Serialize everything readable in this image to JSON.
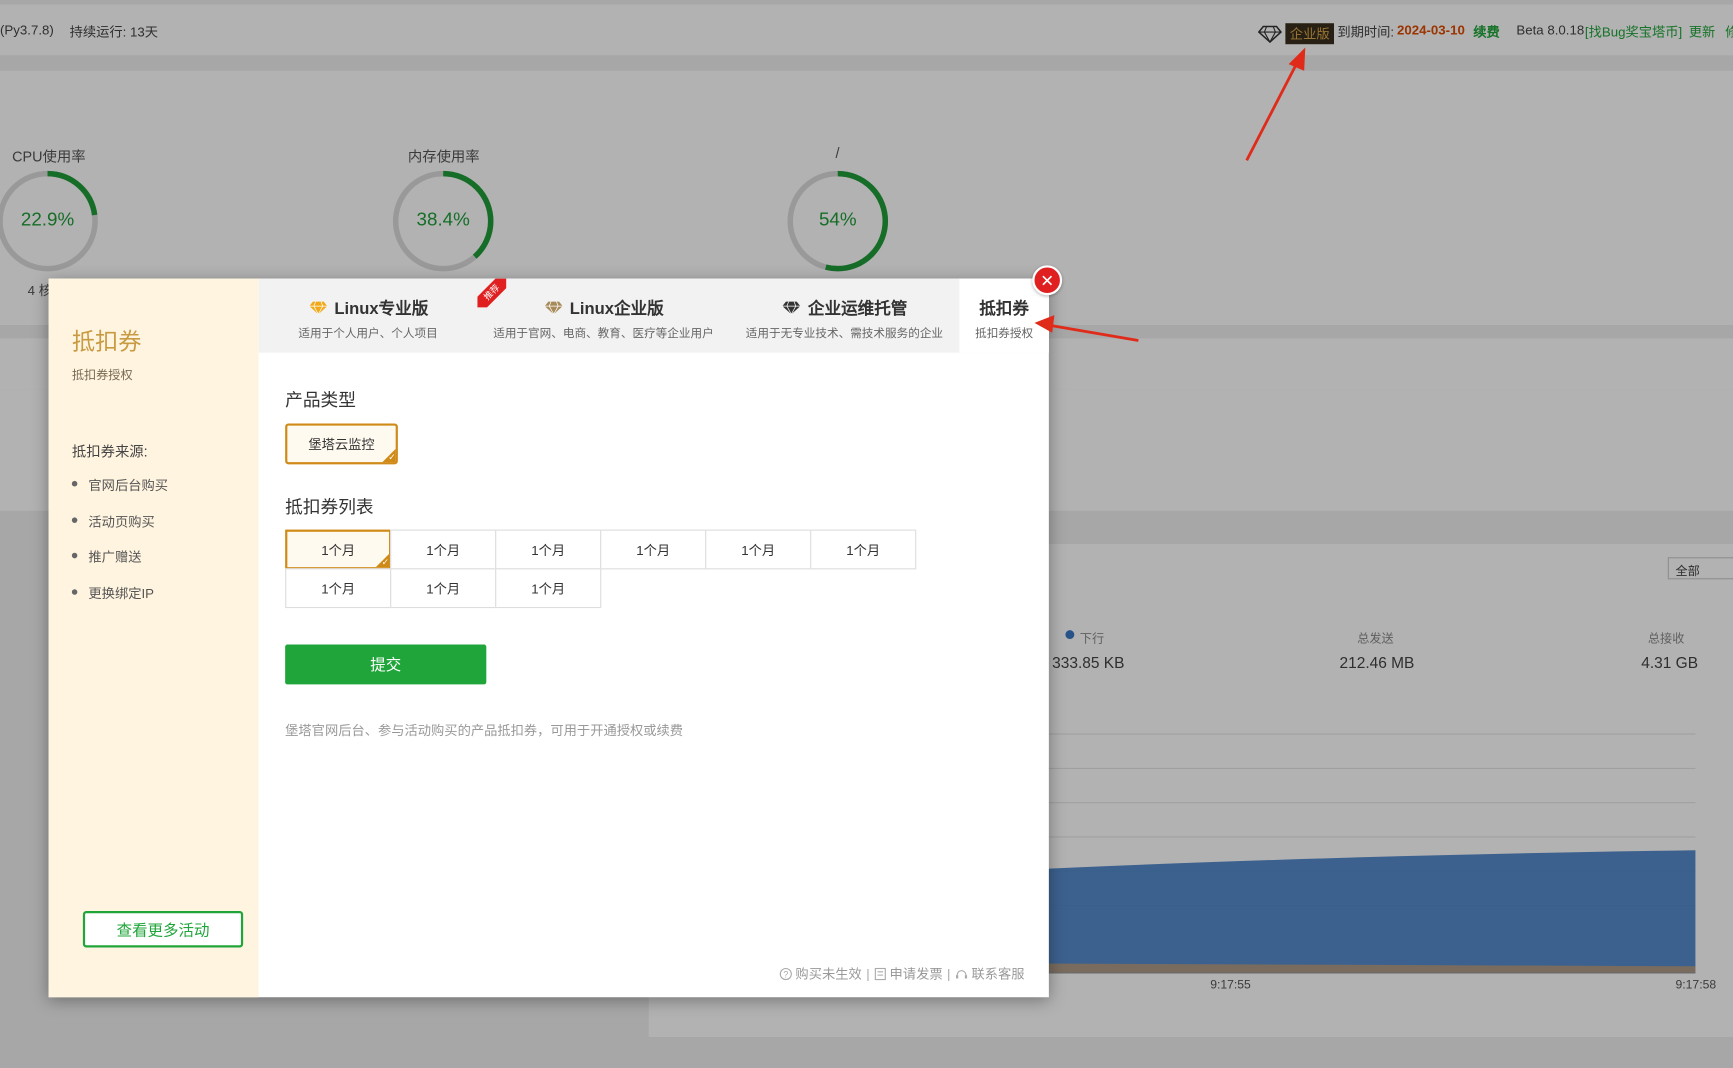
{
  "topbar": {
    "python": "(Py3.7.8)",
    "uptime": "持续运行: 13天",
    "edition": "企业版",
    "expire_label": "到期时间:",
    "expire_date": "2024-03-10",
    "renew": "续费",
    "beta_version": "Beta 8.0.18",
    "bug_link": "[找Bug奖宝塔币]",
    "update": "更新"
  },
  "gauges": [
    {
      "title": "CPU使用率",
      "value": "22.9%",
      "percent": 22.9,
      "extra": "4 核"
    },
    {
      "title": "内存使用率",
      "value": "38.4%",
      "percent": 38.4
    },
    {
      "title": "/",
      "value": "54%",
      "percent": 54
    }
  ],
  "traffic": {
    "filter": "全部",
    "down_label": "下行",
    "down_value": "333.85 KB",
    "sent_label": "总发送",
    "sent_value": "212.46 MB",
    "recv_label": "总接收",
    "recv_value": "4.31 GB",
    "times": [
      "9:17:55",
      "9:17:58"
    ]
  },
  "modal": {
    "side": {
      "title": "抵扣券",
      "subtitle": "抵扣券授权",
      "source_label": "抵扣券来源:",
      "sources": [
        "官网后台购买",
        "活动页购买",
        "推广赠送",
        "更换绑定IP"
      ],
      "more_button": "查看更多活动"
    },
    "tabs": [
      {
        "title": "Linux专业版",
        "subtitle": "适用于个人用户、个人项目"
      },
      {
        "title": "Linux企业版",
        "subtitle": "适用于官网、电商、教育、医疗等企业用户",
        "ribbon": "推荐"
      },
      {
        "title": "企业运维托管",
        "subtitle": "适用于无专业技术、需技术服务的企业"
      },
      {
        "title": "抵扣券",
        "subtitle": "抵扣券授权"
      }
    ],
    "product_type_label": "产品类型",
    "product_type": "堡塔云监控",
    "coupon_list_label": "抵扣券列表",
    "coupons": [
      "1个月",
      "1个月",
      "1个月",
      "1个月",
      "1个月",
      "1个月",
      "1个月",
      "1个月",
      "1个月"
    ],
    "submit": "提交",
    "note": "堡塔官网后台、参与活动购买的产品抵扣券，可用于开通授权或续费",
    "footer": {
      "not_effective": "购买未生效",
      "invoice": "申请发票",
      "support": "联系客服",
      "separator": "|"
    }
  },
  "colors": {
    "accent_green": "#20a53a",
    "gold": "#d08a17",
    "close_red": "#e02020",
    "expire_red": "#e04b00"
  }
}
